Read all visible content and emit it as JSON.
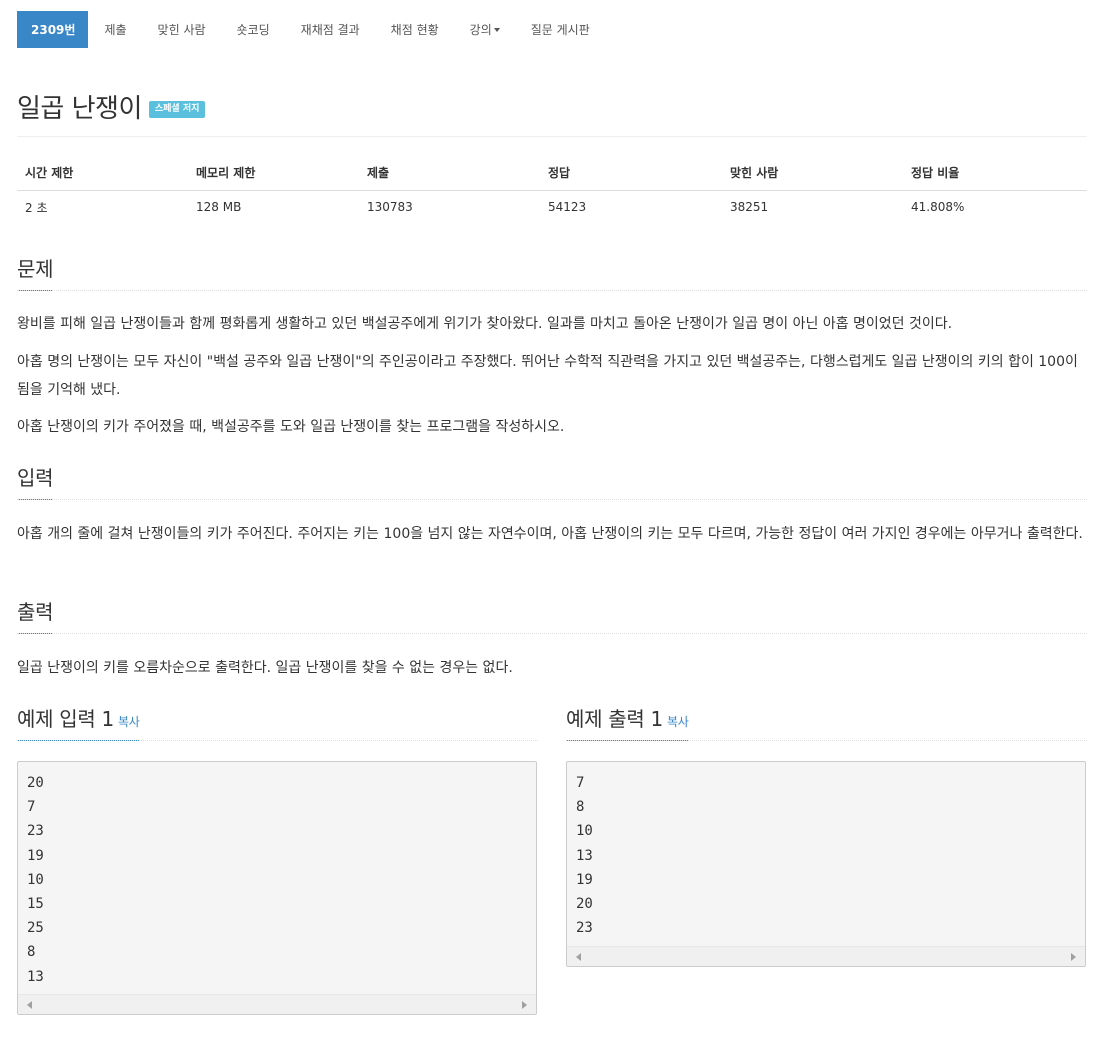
{
  "tabs": [
    {
      "label": "2309번",
      "active": true
    },
    {
      "label": "제출"
    },
    {
      "label": "맞힌 사람"
    },
    {
      "label": "숏코딩"
    },
    {
      "label": "재채점 결과"
    },
    {
      "label": "채점 현황"
    },
    {
      "label": "강의",
      "dropdown": true
    },
    {
      "label": "질문 게시판"
    }
  ],
  "problem": {
    "title": "일곱 난쟁이",
    "badge": "스페셜 저지"
  },
  "info": {
    "headers": [
      "시간 제한",
      "메모리 제한",
      "제출",
      "정답",
      "맞힌 사람",
      "정답 비율"
    ],
    "values": [
      "2 초",
      "128 MB",
      "130783",
      "54123",
      "38251",
      "41.808%"
    ]
  },
  "sections": {
    "problem_heading": "문제",
    "problem_paragraphs": [
      "왕비를 피해 일곱 난쟁이들과 함께 평화롭게 생활하고 있던 백설공주에게 위기가 찾아왔다. 일과를 마치고 돌아온 난쟁이가 일곱 명이 아닌 아홉 명이었던 것이다.",
      "아홉 명의 난쟁이는 모두 자신이 \"백설 공주와 일곱 난쟁이\"의 주인공이라고 주장했다. 뛰어난 수학적 직관력을 가지고 있던 백설공주는, 다행스럽게도 일곱 난쟁이의 키의 합이 100이 됨을 기억해 냈다.",
      "아홉 난쟁이의 키가 주어졌을 때, 백설공주를 도와 일곱 난쟁이를 찾는 프로그램을 작성하시오."
    ],
    "input_heading": "입력",
    "input_text": "아홉 개의 줄에 걸쳐 난쟁이들의 키가 주어진다. 주어지는 키는 100을 넘지 않는 자연수이며, 아홉 난쟁이의 키는 모두 다르며, 가능한 정답이 여러 가지인 경우에는 아무거나 출력한다.",
    "output_heading": "출력",
    "output_text": "일곱 난쟁이의 키를 오름차순으로 출력한다. 일곱 난쟁이를 찾을 수 없는 경우는 없다."
  },
  "samples": {
    "input_heading": "예제 입력 1",
    "output_heading": "예제 출력 1",
    "copy_label": "복사",
    "input_text": "20\n7\n23\n19\n10\n15\n25\n8\n13",
    "output_text": "7\n8\n10\n13\n19\n20\n23"
  },
  "colors": {
    "accent": "#3a87c8",
    "badge": "#5bc0de"
  }
}
